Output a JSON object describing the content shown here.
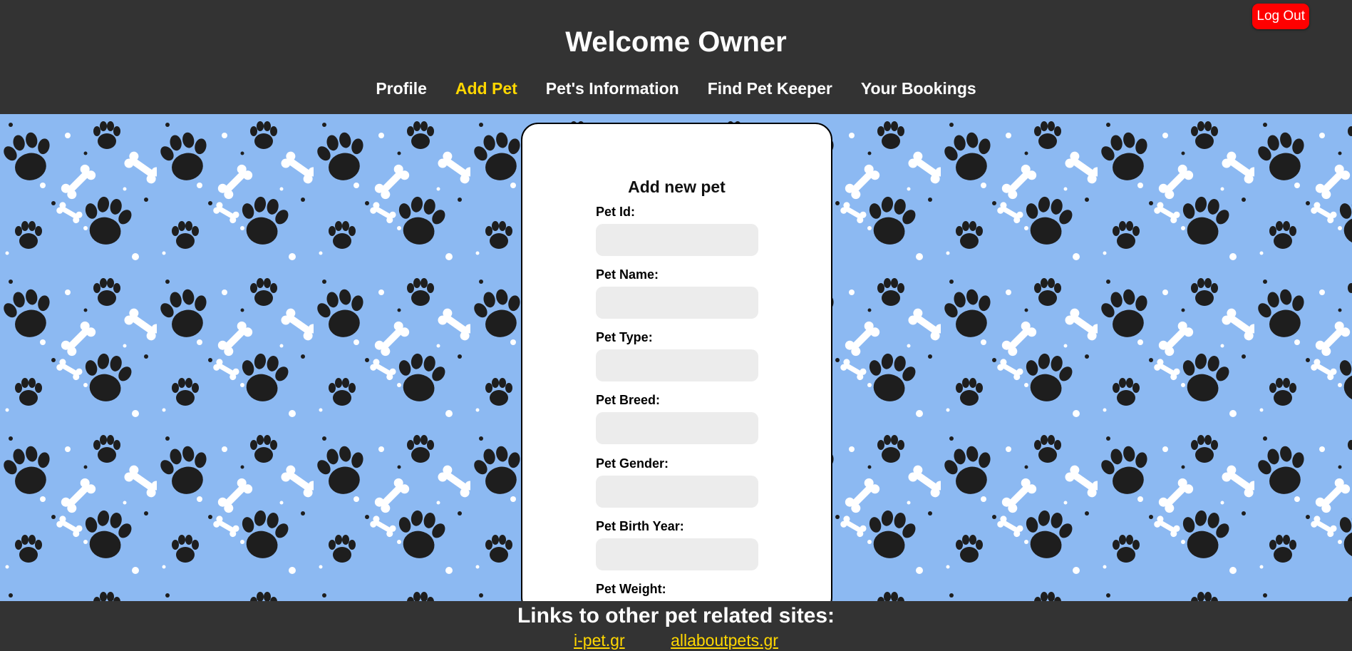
{
  "header": {
    "title": "Welcome Owner",
    "logout_label": "Log Out",
    "nav": [
      {
        "label": "Profile",
        "active": false
      },
      {
        "label": "Add Pet",
        "active": true
      },
      {
        "label": "Pet's Information",
        "active": false
      },
      {
        "label": "Find Pet Keeper",
        "active": false
      },
      {
        "label": "Your Bookings",
        "active": false
      }
    ]
  },
  "form": {
    "title": "Add new pet",
    "fields": [
      {
        "label": "Pet Id:",
        "value": ""
      },
      {
        "label": "Pet Name:",
        "value": ""
      },
      {
        "label": "Pet Type:",
        "value": ""
      },
      {
        "label": "Pet Breed:",
        "value": ""
      },
      {
        "label": "Pet Gender:",
        "value": ""
      },
      {
        "label": "Pet Birth Year:",
        "value": ""
      },
      {
        "label": "Pet Weight:",
        "value": ""
      }
    ]
  },
  "footer": {
    "title": "Links to other pet related sites:",
    "links": [
      "i-pet.gr",
      "allaboutpets.gr"
    ]
  },
  "colors": {
    "bar_bg": "#333333",
    "accent": "#ffd700",
    "logout_bg": "#ff0000",
    "pattern_bg": "#8cb9f2"
  },
  "icons": [
    "paw-print-icon",
    "bone-icon"
  ]
}
